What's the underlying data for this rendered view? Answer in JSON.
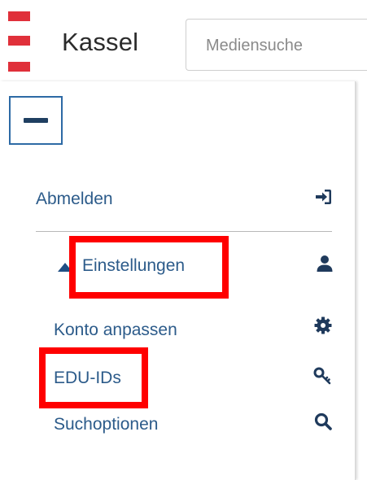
{
  "header": {
    "city_name": "Kassel",
    "logo": "kassel-logo",
    "search": {
      "placeholder": "Mediensuche",
      "value": ""
    }
  },
  "menu": {
    "collapse_icon": "minus-icon",
    "logout": {
      "label": "Abmelden",
      "icon": "sign-in-icon"
    },
    "settings": {
      "label": "Einstellungen",
      "icon": "user-icon",
      "expanded": true,
      "items": [
        {
          "label": "Konto anpassen",
          "icon": "gear-icon"
        },
        {
          "label": "EDU-IDs",
          "icon": "key-icon"
        },
        {
          "label": "Suchoptionen",
          "icon": "search-icon"
        }
      ]
    }
  },
  "colors": {
    "link": "#2c5b8a",
    "icon": "#1f3a5c",
    "logo_red": "#e0303a",
    "button_border": "#2d6aa5",
    "highlight": "#ff0000"
  }
}
